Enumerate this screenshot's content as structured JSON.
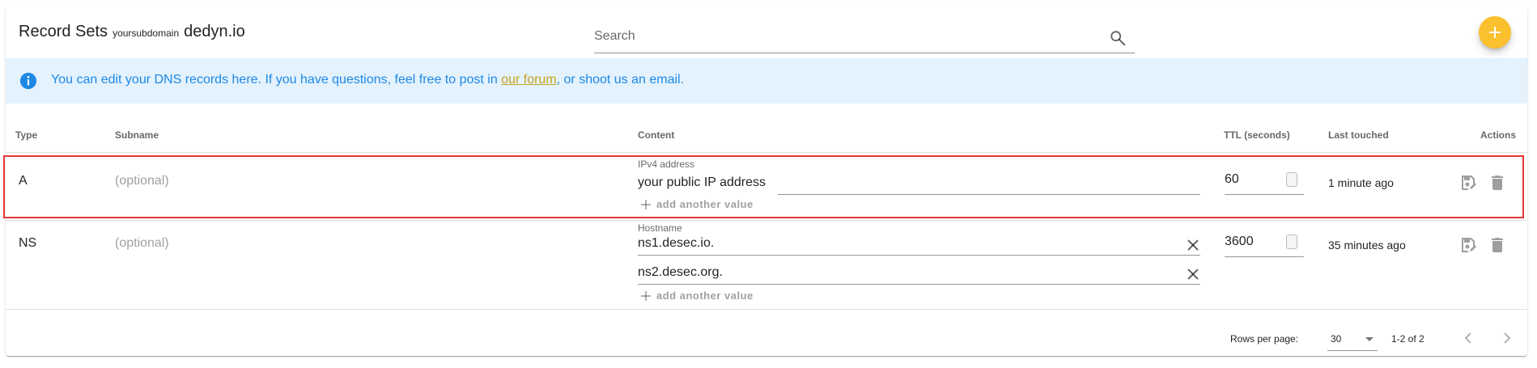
{
  "toolbar": {
    "title": "Record Sets",
    "subdomain": "yoursubdomain",
    "domain": "dedyn.io",
    "search_placeholder": "Search"
  },
  "alert": {
    "text_before": "You can edit your DNS records here. If you have questions, feel free to post in ",
    "link_text": "our forum",
    "text_after": ", or shoot us an email."
  },
  "table": {
    "headers": {
      "type": "Type",
      "subname": "Subname",
      "content": "Content",
      "ttl": "TTL (seconds)",
      "touched": "Last touched",
      "actions": "Actions"
    },
    "rows": [
      {
        "type": "A",
        "subname_placeholder": "(optional)",
        "content_label": "IPv4 address",
        "values": [
          "your public IP address"
        ],
        "add_value": "add another value",
        "ttl": "60",
        "touched": "1 minute ago"
      },
      {
        "type": "NS",
        "subname_placeholder": "(optional)",
        "content_label": "Hostname",
        "values": [
          "ns1.desec.io.",
          "ns2.desec.org."
        ],
        "add_value": "add another value",
        "ttl": "3600",
        "touched": "35 minutes ago"
      }
    ]
  },
  "footer": {
    "rows_per_page_label": "Rows per page:",
    "rows_per_page_value": "30",
    "range": "1-2 of 2"
  },
  "colors": {
    "accent": "#fbc02d",
    "info_bg": "#e3f2fd",
    "info_text": "#1e88e5",
    "link": "#c8a21e",
    "highlight": "#e53935"
  },
  "icons": [
    "search-icon",
    "plus-icon",
    "info-icon",
    "close-icon",
    "save-icon",
    "delete-icon",
    "chevron-down-icon",
    "chevron-left-icon",
    "chevron-right-icon"
  ]
}
